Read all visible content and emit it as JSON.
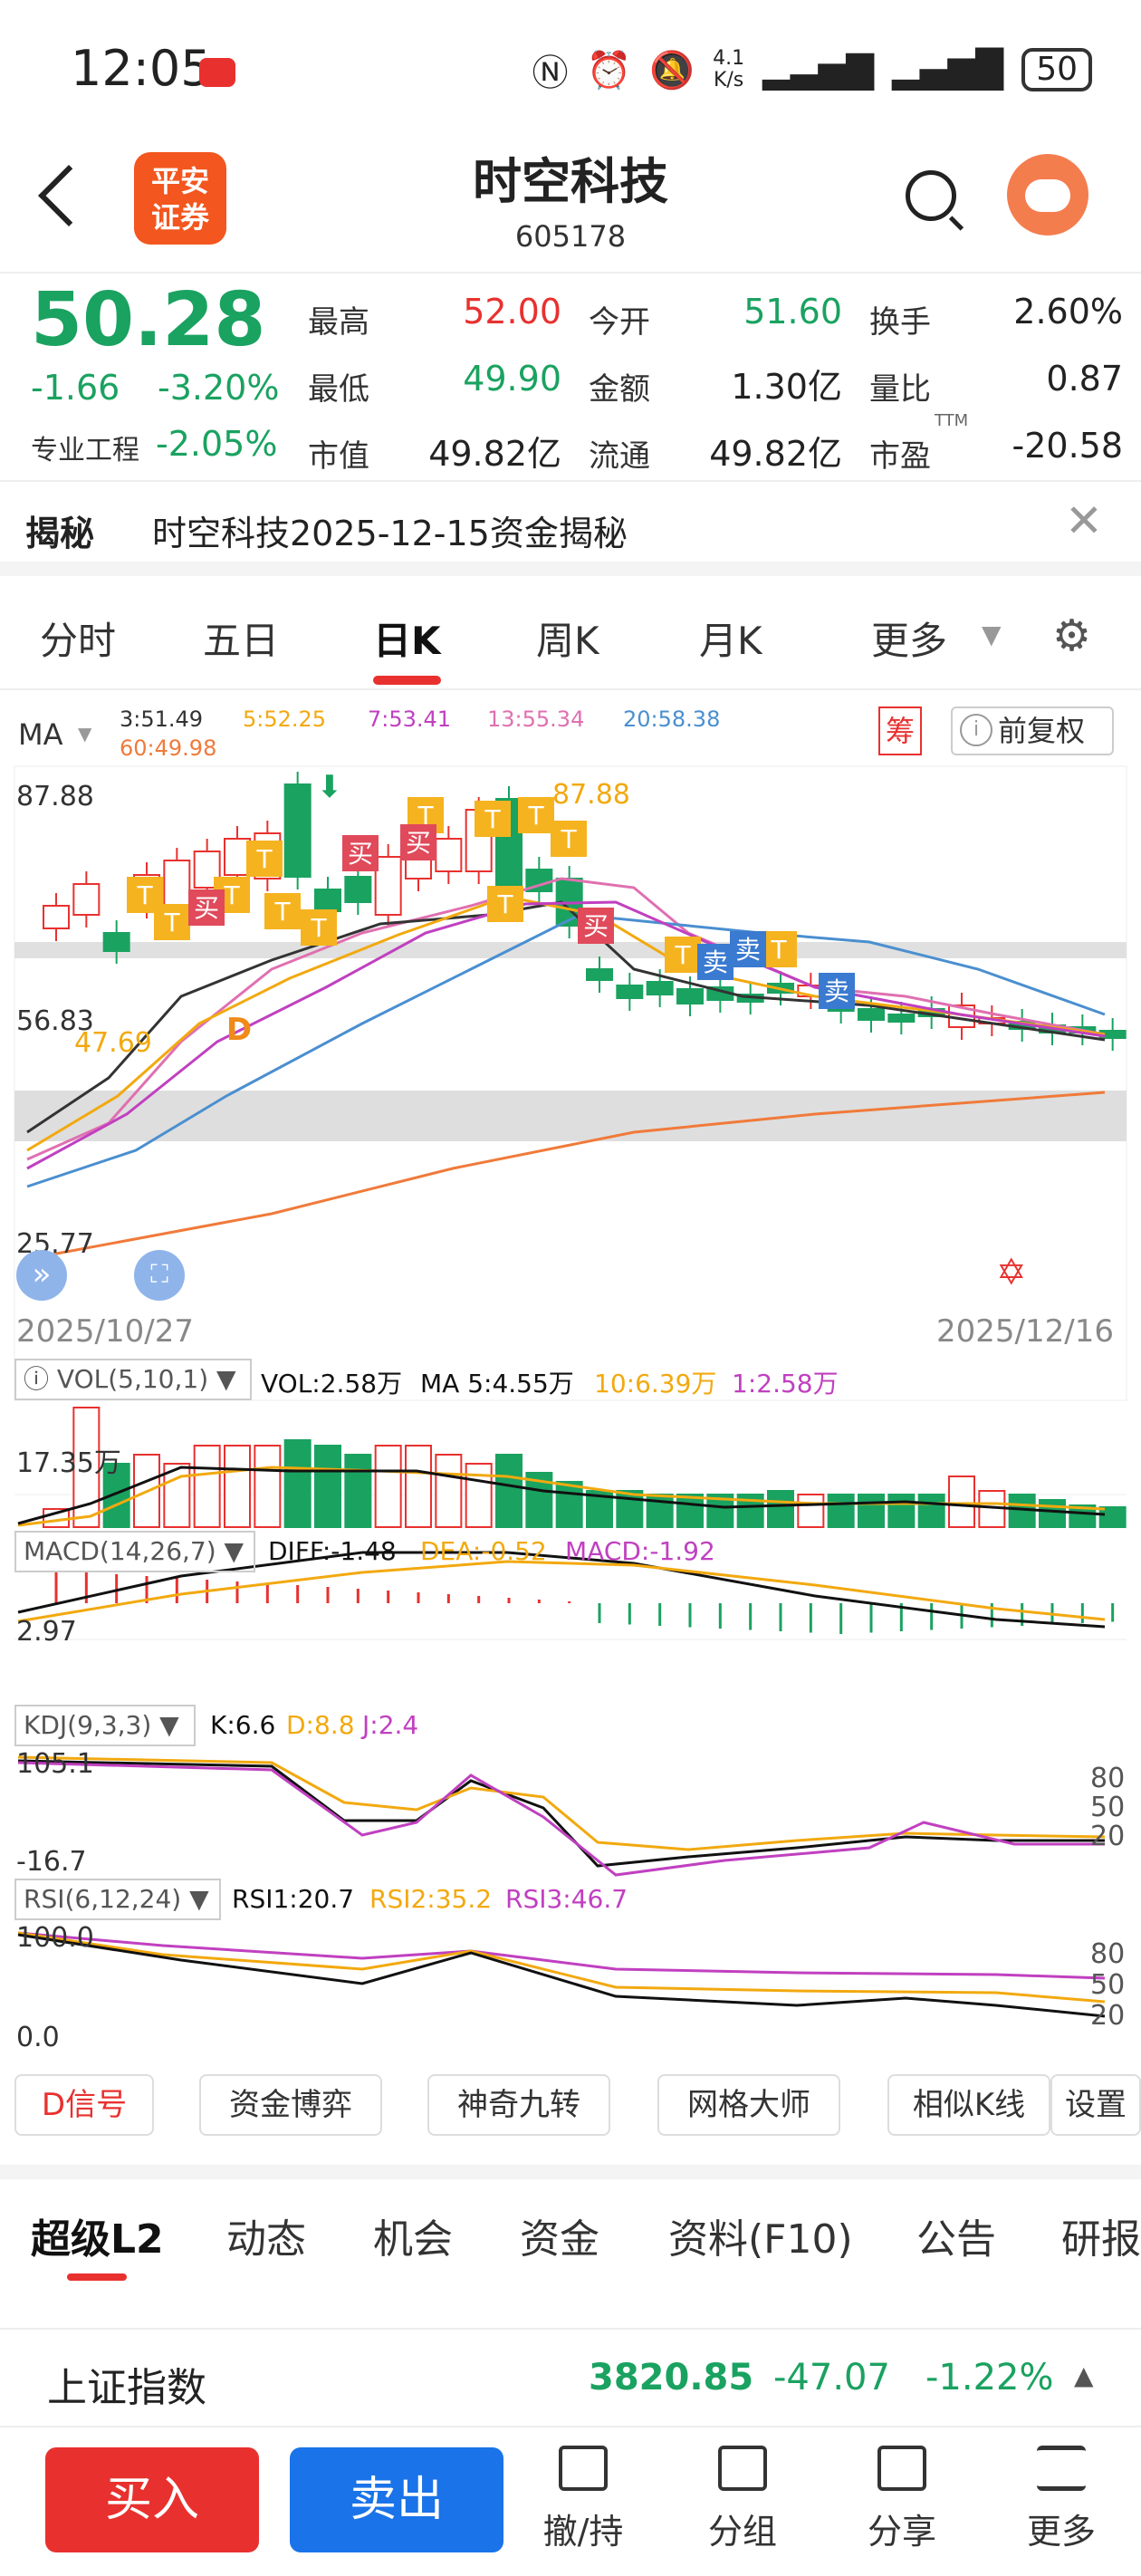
{
  "status": {
    "time": "12:05",
    "net_top": "4.1",
    "net_bot": "K/s",
    "battery": "50"
  },
  "header": {
    "logo_l1": "平安",
    "logo_l2": "证券",
    "title": "时空科技",
    "code": "605178"
  },
  "quote": {
    "price": "50.28",
    "change": "-1.66",
    "change_pct": "-3.20%",
    "sector": "专业工程",
    "sector_pct": "-2.05%",
    "f": [
      {
        "l": "最高",
        "v": "52.00",
        "c": "red"
      },
      {
        "l": "今开",
        "v": "51.60",
        "c": "grn"
      },
      {
        "l": "换手",
        "v": "2.60%",
        "c": ""
      },
      {
        "l": "最低",
        "v": "49.90",
        "c": "grn"
      },
      {
        "l": "金额",
        "v": "1.30亿",
        "c": ""
      },
      {
        "l": "量比",
        "v": "0.87",
        "c": ""
      },
      {
        "l": "市值",
        "v": "49.82亿",
        "c": ""
      },
      {
        "l": "流通",
        "v": "49.82亿",
        "c": ""
      },
      {
        "l": "市盈",
        "v": "-20.58",
        "c": ""
      }
    ],
    "ttm": "TTM"
  },
  "notice": {
    "tag": "揭秘",
    "text": "时空科技2025-12-15资金揭秘"
  },
  "tabs": [
    "分时",
    "五日",
    "日K",
    "周K",
    "月K",
    "更多"
  ],
  "chart": {
    "ma_label": "MA",
    "ma": [
      {
        "t": "3:51.49",
        "c": "#333"
      },
      {
        "t": "5:52.25",
        "c": "#f2a90f"
      },
      {
        "t": "7:53.41",
        "c": "#c040c0"
      },
      {
        "t": "13:55.34",
        "c": "#e070b0"
      },
      {
        "t": "20:58.38",
        "c": "#4a8fd0"
      },
      {
        "t": "60:49.98",
        "c": "#f07a3a"
      }
    ],
    "chou": "筹",
    "fq": "前复权",
    "y_top": "87.88",
    "y_mid": "56.83",
    "y_low": "25.77",
    "hi_mark": "87.88",
    "lo_mark": "47.69",
    "date_l": "2025/10/27",
    "date_r": "2025/12/16",
    "vol": {
      "name": "VOL(5,10,1)",
      "v": "VOL:2.58万",
      "m5": "MA 5:4.55万",
      "m10": "10:6.39万",
      "m1": "1:2.58万",
      "ytick": "17.35万"
    },
    "macd": {
      "name": "MACD(14,26,7)",
      "diff": "DIFF:-1.48",
      "dea": "DEA:-0.52",
      "m": "MACD:-1.92",
      "ytick": "2.97"
    },
    "kdj": {
      "name": "KDJ(9,3,3)",
      "k": "K:6.6",
      "d": "D:8.8",
      "j": "J:2.4",
      "ytop": "105.1",
      "ybot": "-16.7",
      "r1": "80",
      "r2": "50",
      "r3": "20"
    },
    "rsi": {
      "name": "RSI(6,12,24)",
      "r1": "RSI1:20.7",
      "r2": "RSI2:35.2",
      "r3": "RSI3:46.7",
      "ytop": "100.0",
      "ybot": "0.0",
      "a": "80",
      "b": "50",
      "c": "20"
    },
    "markers": {
      "buy": "买",
      "sell": "卖",
      "t": "T",
      "d": "D"
    }
  },
  "tools": [
    "D信号",
    "资金博弈",
    "神奇九转",
    "网格大师",
    "相似K线",
    "设置"
  ],
  "subtabs": [
    "超级L2",
    "动态",
    "机会",
    "资金",
    "资料(F10)",
    "公告",
    "研报"
  ],
  "index": {
    "name": "上证指数",
    "price": "3820.85",
    "chg": "-47.07",
    "pct": "-1.22%"
  },
  "bottom": {
    "buy": "买入",
    "sell": "卖出",
    "b1": "撤/持",
    "b2": "分组",
    "b3": "分享",
    "b4": "更多"
  }
}
